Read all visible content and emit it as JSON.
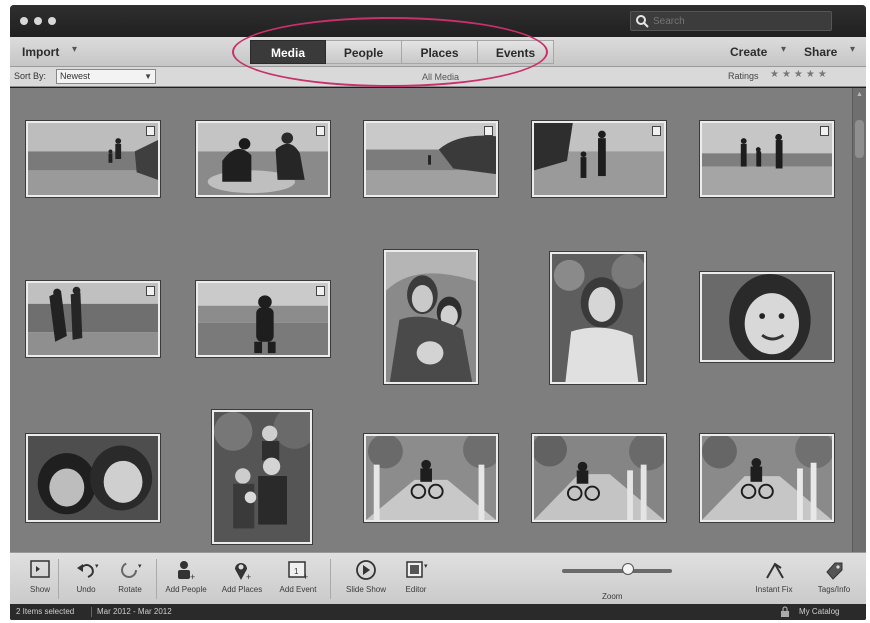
{
  "titlebar": {
    "search_placeholder": "Search"
  },
  "nav": {
    "import_label": "Import",
    "tabs": [
      {
        "label": "Media",
        "active": true
      },
      {
        "label": "People",
        "active": false
      },
      {
        "label": "Places",
        "active": false
      },
      {
        "label": "Events",
        "active": false
      }
    ],
    "create_label": "Create",
    "share_label": "Share"
  },
  "sortbar": {
    "sort_label": "Sort By:",
    "sort_value": "Newest",
    "center_label": "All Media",
    "ratings_label": "Ratings",
    "stars": "★★★★★"
  },
  "grid": {
    "thumbnails": [
      {
        "subject": "beach-child-and-adult",
        "has_stack_badge": true
      },
      {
        "subject": "family-sitting-on-rocks",
        "has_stack_badge": true
      },
      {
        "subject": "beach-rocky-shore",
        "has_stack_badge": true
      },
      {
        "subject": "family-walking-on-beach",
        "has_stack_badge": true
      },
      {
        "subject": "family-holding-hands-beach",
        "has_stack_badge": true
      },
      {
        "subject": "couple-at-water-edge",
        "has_stack_badge": true
      },
      {
        "subject": "child-sitting-on-beach",
        "has_stack_badge": true
      },
      {
        "subject": "mother-and-two-children-portrait",
        "has_stack_badge": false
      },
      {
        "subject": "girl-portrait-trees",
        "has_stack_badge": false
      },
      {
        "subject": "girl-smiling-closeup",
        "has_stack_badge": false
      },
      {
        "subject": "two-kids-smiling",
        "has_stack_badge": false
      },
      {
        "subject": "family-group-portrait",
        "has_stack_badge": false
      },
      {
        "subject": "bikes-on-bridge",
        "has_stack_badge": false
      },
      {
        "subject": "bikes-on-bridge",
        "has_stack_badge": false
      },
      {
        "subject": "bikes-on-bridge",
        "has_stack_badge": false
      }
    ]
  },
  "toolbar": {
    "show_label": "Show",
    "undo_label": "Undo",
    "rotate_label": "Rotate",
    "add_people_label": "Add People",
    "add_places_label": "Add Places",
    "add_event_label": "Add Event",
    "slide_show_label": "Slide Show",
    "editor_label": "Editor",
    "zoom_label": "Zoom",
    "zoom_level": 0.6,
    "instant_fix_label": "Instant Fix",
    "tags_info_label": "Tags/Info"
  },
  "status": {
    "selected": "2 Items selected",
    "range": "Mar 2012 - Mar 2012",
    "catalog": "My Catalog"
  }
}
